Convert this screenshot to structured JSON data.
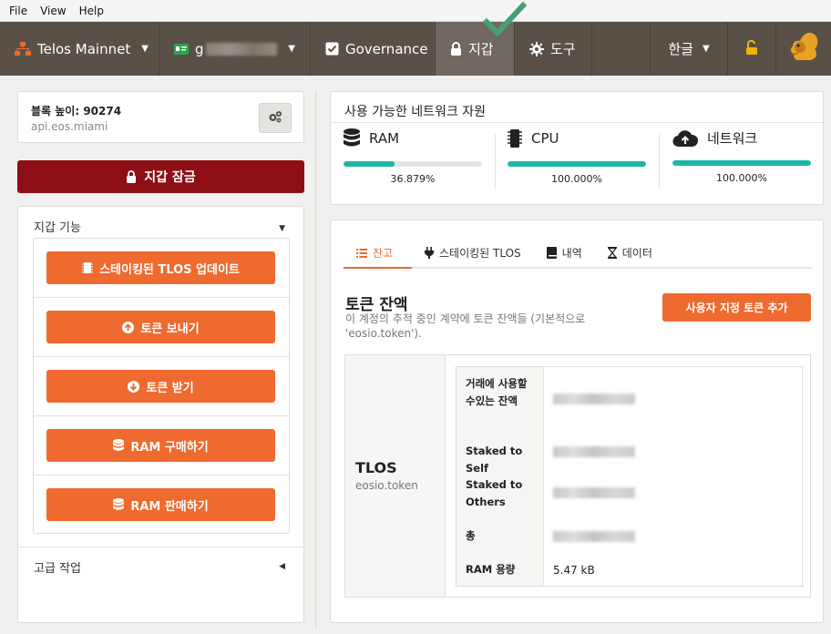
{
  "menubar": {
    "items": [
      "File",
      "View",
      "Help"
    ]
  },
  "nav": {
    "network": "Telos Mainnet",
    "account": "g",
    "governance": "Governance",
    "wallet": "지갑",
    "tools": "도구",
    "language": "한글"
  },
  "block": {
    "height_label": "블록 높이: 90274",
    "endpoint": "api.eos.miami"
  },
  "lock_button": "지갑 잠금",
  "wallet_functions": {
    "title": "지갑 기능",
    "actions": [
      {
        "label": "스테이킹된 TLOS 업데이트",
        "icon": "chip-icon"
      },
      {
        "label": "토큰 보내기",
        "icon": "arrow-up-circle-icon"
      },
      {
        "label": "토큰 받기",
        "icon": "arrow-down-circle-icon"
      },
      {
        "label": "RAM 구매하기",
        "icon": "database-icon"
      },
      {
        "label": "RAM 판매하기",
        "icon": "database-icon"
      }
    ],
    "advanced": "고급 작업"
  },
  "resources": {
    "title": "사용 가능한 네트워크 자원",
    "items": [
      {
        "name": "RAM",
        "percent_label": "36.879%",
        "value": 36.879
      },
      {
        "name": "CPU",
        "percent_label": "100.000%",
        "value": 100.0
      },
      {
        "name": "네트워크",
        "percent_label": "100.000%",
        "value": 100.0
      }
    ]
  },
  "tabs": [
    "잔고",
    "스테이킹된 TLOS",
    "내역",
    "데이터"
  ],
  "token_balances": {
    "title": "토큰 잔액",
    "description": "이 계정의 추적 중인 계약에 토큰 잔액들 (기본적으로 'eosio.token').",
    "add_button": "사용자 지정 토큰 추가",
    "token": {
      "symbol": "TLOS",
      "contract": "eosio.token"
    },
    "rows": [
      {
        "label": "거래에 사용할 수있는 잔액"
      },
      {
        "label": "Staked to Self"
      },
      {
        "label": "Staked to Others"
      },
      {
        "label": "총"
      },
      {
        "label": "RAM 용량",
        "value": "5.47 kB"
      }
    ]
  },
  "colors": {
    "accent": "#ee6a2e",
    "danger": "#8d0e15",
    "nav_bg": "#595148",
    "progress": "#1cb6a7",
    "unlock": "#f0b400"
  }
}
